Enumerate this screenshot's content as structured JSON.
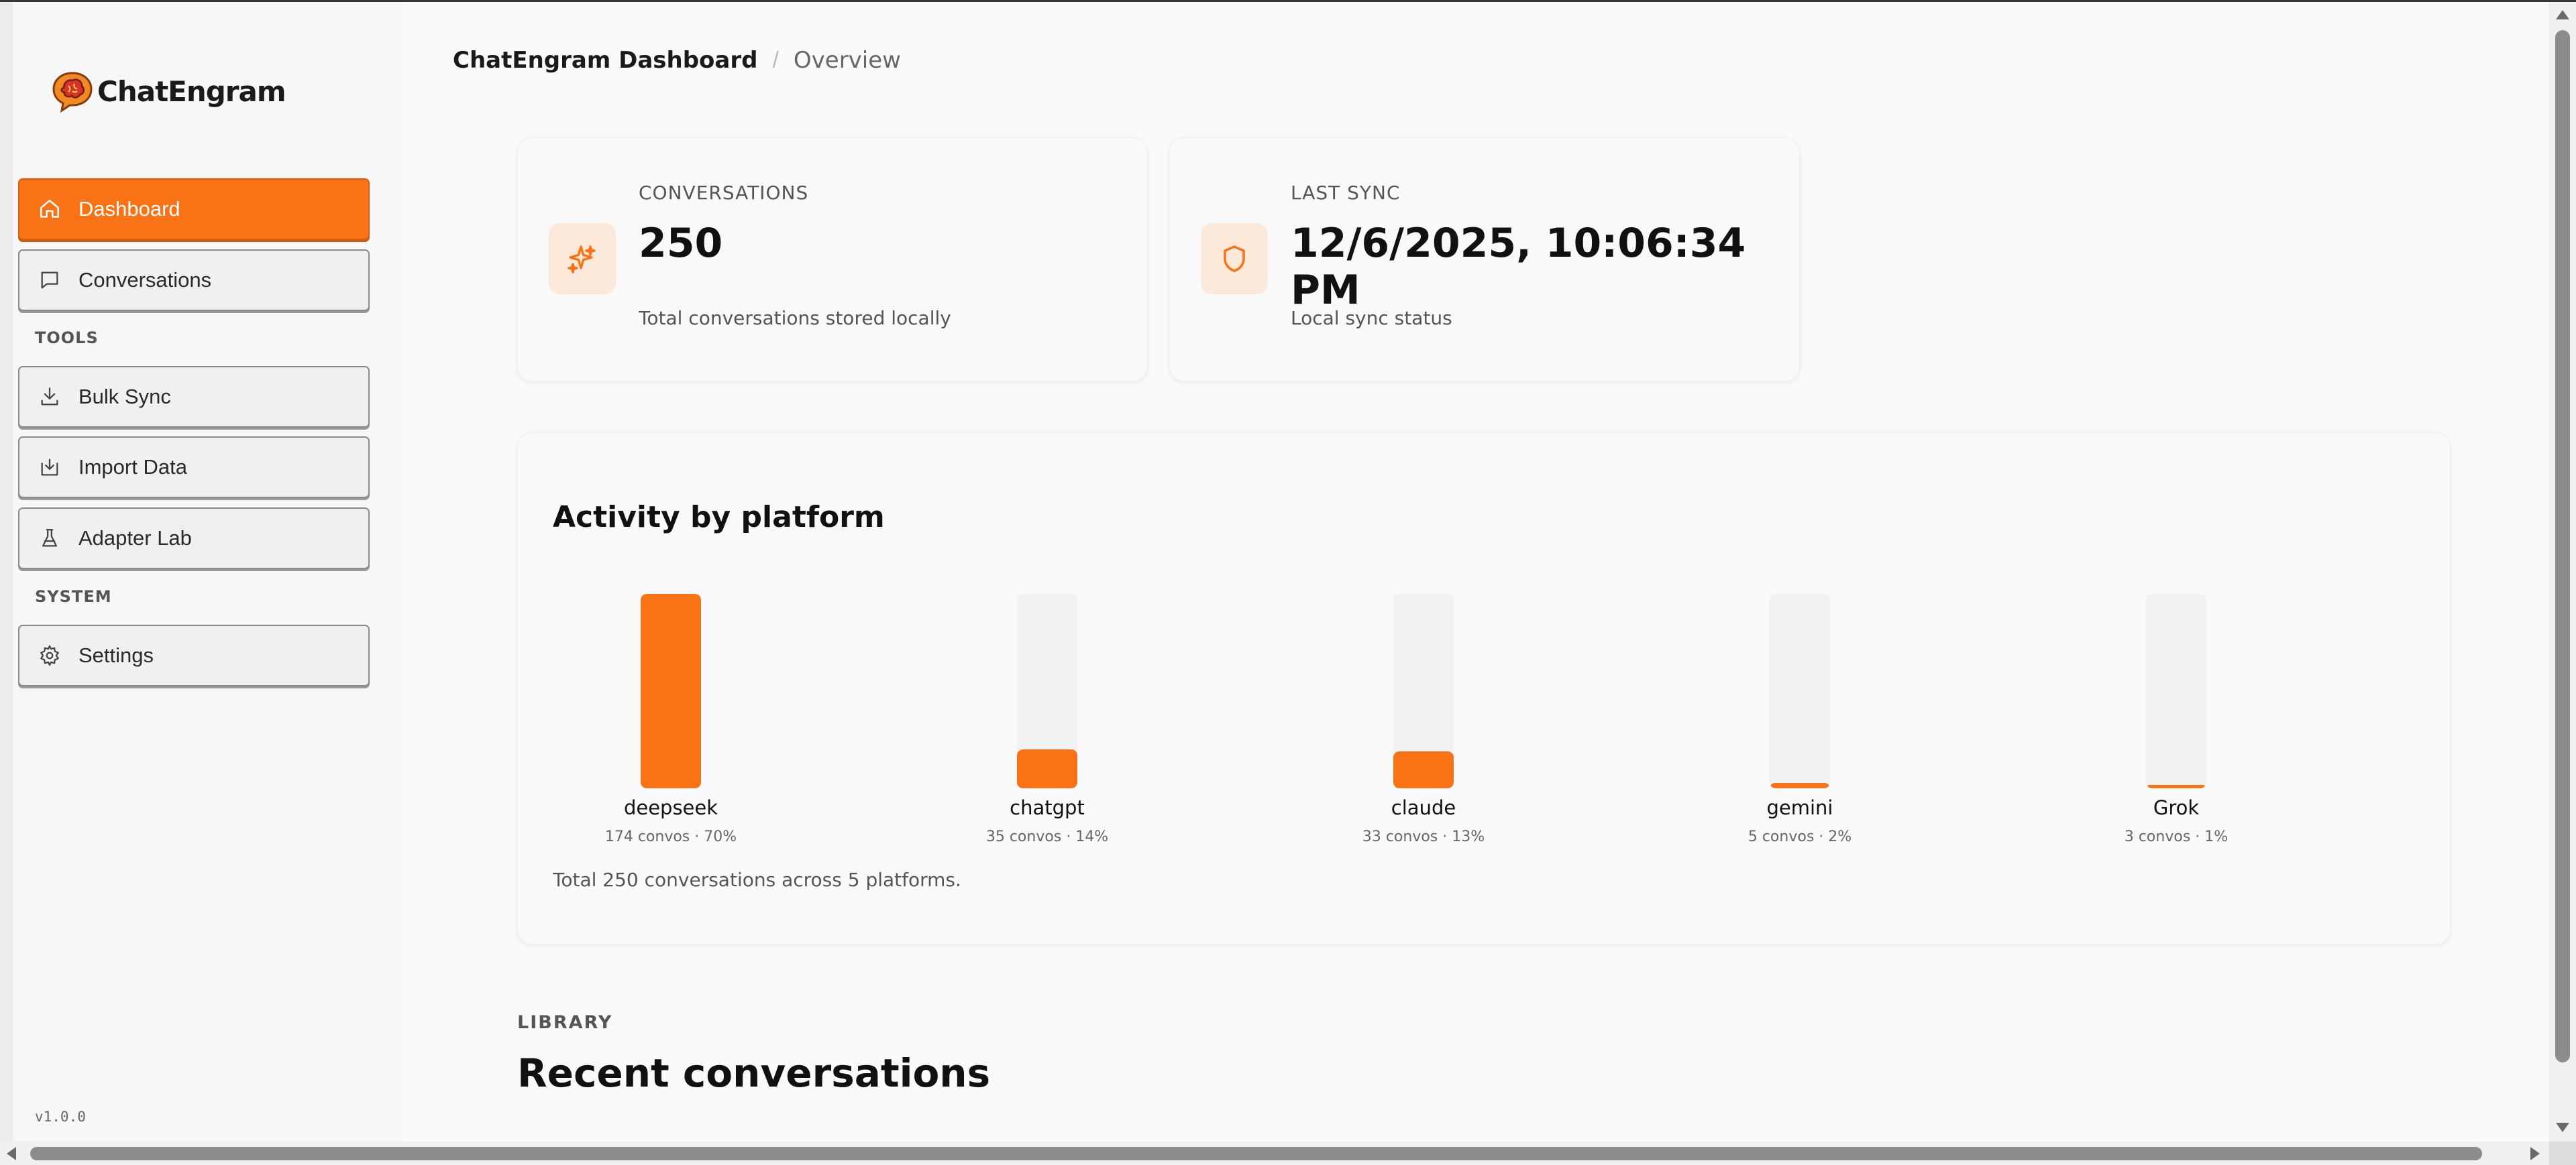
{
  "app": {
    "name": "ChatEngram",
    "version": "v1.0.0"
  },
  "breadcrumb": {
    "title": "ChatEngram Dashboard",
    "separator": "/",
    "current": "Overview"
  },
  "sidebar": {
    "nav": [
      {
        "label": "Dashboard",
        "icon": "home-icon",
        "active": true
      },
      {
        "label": "Conversations",
        "icon": "chat-bubble-icon",
        "active": false
      }
    ],
    "tools_label": "TOOLS",
    "tools": [
      {
        "label": "Bulk Sync",
        "icon": "download-icon"
      },
      {
        "label": "Import Data",
        "icon": "import-icon"
      },
      {
        "label": "Adapter Lab",
        "icon": "flask-icon"
      }
    ],
    "system_label": "SYSTEM",
    "system": [
      {
        "label": "Settings",
        "icon": "gear-icon"
      }
    ]
  },
  "stats": [
    {
      "label": "CONVERSATIONS",
      "value": "250",
      "description": "Total conversations stored locally",
      "icon": "sparkle-icon"
    },
    {
      "label": "LAST SYNC",
      "value": "12/6/2025, 10:06:34 PM",
      "description": "Local sync status",
      "icon": "shield-icon"
    }
  ],
  "activity": {
    "title": "Activity by platform",
    "total_text": "Total 250 conversations across 5 platforms."
  },
  "chart_data": {
    "type": "bar",
    "title": "Activity by platform",
    "categories": [
      "deepseek",
      "chatgpt",
      "claude",
      "gemini",
      "Grok"
    ],
    "values": [
      174,
      35,
      33,
      5,
      3
    ],
    "sublabels": [
      "174 convos · 70%",
      "35 convos · 14%",
      "33 convos · 13%",
      "5 convos · 2%",
      "3 convos · 1%"
    ],
    "ylim": [
      0,
      174
    ],
    "grid": false
  },
  "library": {
    "label": "LIBRARY",
    "title": "Recent conversations"
  },
  "colors": {
    "accent": "#f97316",
    "accent_soft": "#fde9da",
    "track": "#f2f2f2"
  }
}
